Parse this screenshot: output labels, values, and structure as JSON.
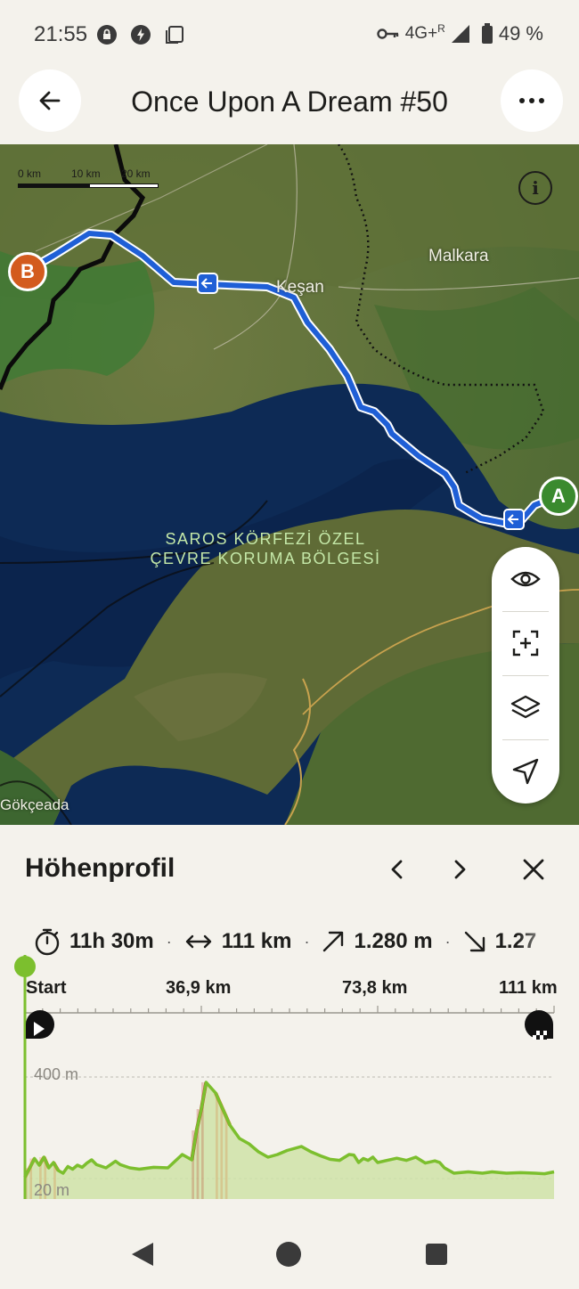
{
  "status_bar": {
    "time": "21:55",
    "network": "4G+",
    "roaming": "R",
    "battery": "49 %",
    "icons_left": [
      "lock-notification-icon",
      "bolt-notification-icon",
      "copy-notification-icon"
    ],
    "icons_right": [
      "vpn-key-icon",
      "signal-icon",
      "battery-icon"
    ]
  },
  "header": {
    "title": "Once Upon A Dream #50",
    "back_icon": "arrow-left-icon",
    "menu_icon": "more-horizontal-icon"
  },
  "map": {
    "scale": {
      "ticks": [
        "0 km",
        "10 km",
        "20 km"
      ]
    },
    "places": {
      "malkara": "Malkara",
      "kesan": "Keşan",
      "gokceada": "Gökçeada"
    },
    "sea_label_line1": "SAROS KÖRFEZİ ÖZEL",
    "sea_label_line2": "ÇEVRE KORUMA BÖLGESİ",
    "marker_start": "A",
    "marker_end": "B",
    "colors": {
      "route": "#1f5fd6",
      "marker_start": "#3a8a2e",
      "marker_end": "#d35b1e"
    },
    "tools": [
      "eye-icon",
      "zoom-to-route-icon",
      "layers-icon",
      "locate-icon"
    ]
  },
  "elevation_panel": {
    "title": "Höhenprofil",
    "stats": {
      "duration": "11h 30m",
      "distance": "111 km",
      "ascent": "1.280 m",
      "descent": "1.27"
    },
    "axis": {
      "start": "Start",
      "tick1": "36,9 km",
      "tick2": "73,8 km",
      "end": "111 km"
    },
    "elevation_labels": {
      "top": "400 m",
      "bottom": "20 m"
    },
    "chart_data": {
      "type": "area",
      "x_unit": "km",
      "y_unit": "m",
      "xlim": [
        0,
        111
      ],
      "x": [
        0,
        1,
        2,
        3,
        4,
        5,
        6,
        7,
        8,
        9,
        10,
        11,
        12,
        13,
        14,
        15,
        17,
        19,
        20,
        22,
        24,
        27,
        30,
        33,
        35,
        36,
        37,
        38,
        39,
        40,
        41,
        42,
        43,
        45,
        47,
        49,
        51,
        53,
        55,
        56,
        58,
        60,
        62,
        64,
        66,
        68,
        69,
        70,
        71,
        72,
        73,
        74,
        76,
        78,
        80,
        82,
        84,
        86,
        87,
        88,
        90,
        93,
        96,
        98,
        101,
        104,
        107,
        109,
        111
      ],
      "y": [
        25,
        60,
        95,
        70,
        100,
        60,
        80,
        50,
        40,
        65,
        55,
        70,
        62,
        78,
        90,
        72,
        60,
        85,
        72,
        60,
        55,
        62,
        60,
        110,
        90,
        200,
        280,
        380,
        360,
        340,
        300,
        260,
        220,
        170,
        150,
        120,
        100,
        110,
        125,
        130,
        140,
        120,
        105,
        92,
        88,
        110,
        108,
        80,
        95,
        88,
        100,
        80,
        88,
        96,
        88,
        100,
        78,
        86,
        80,
        60,
        40,
        45,
        40,
        45,
        40,
        42,
        40,
        38,
        45
      ],
      "colors": {
        "line": "#7cbf2e",
        "fill": "#cfe3a8",
        "steep": "#d9742a",
        "very_steep": "#b8321f"
      },
      "grid": true
    }
  },
  "nav_bar": {
    "icons": [
      "back-triangle-icon",
      "home-circle-icon",
      "recents-square-icon"
    ]
  }
}
